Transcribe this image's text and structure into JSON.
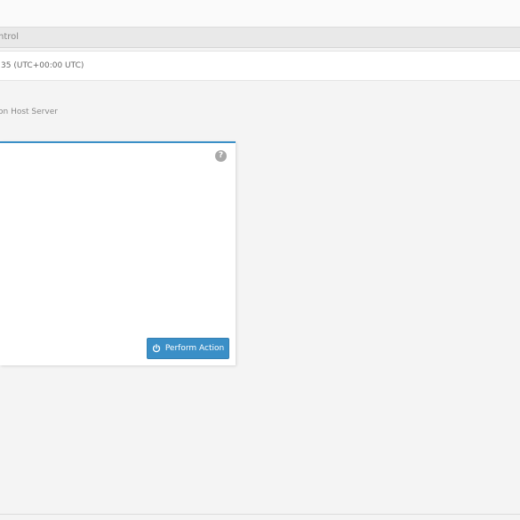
{
  "header": {
    "tab_label": "ntrol",
    "time_text": ":35 (UTC+00:00 UTC)"
  },
  "page": {
    "subtitle": "on Host Server"
  },
  "panel": {
    "help_icon": "question-circle-icon",
    "help_glyph": "?",
    "action_button": {
      "label": "Perform Action",
      "icon": "power-icon"
    }
  },
  "colors": {
    "accent": "#3a8fc7",
    "background": "#f4f4f4",
    "panel": "#ffffff"
  }
}
